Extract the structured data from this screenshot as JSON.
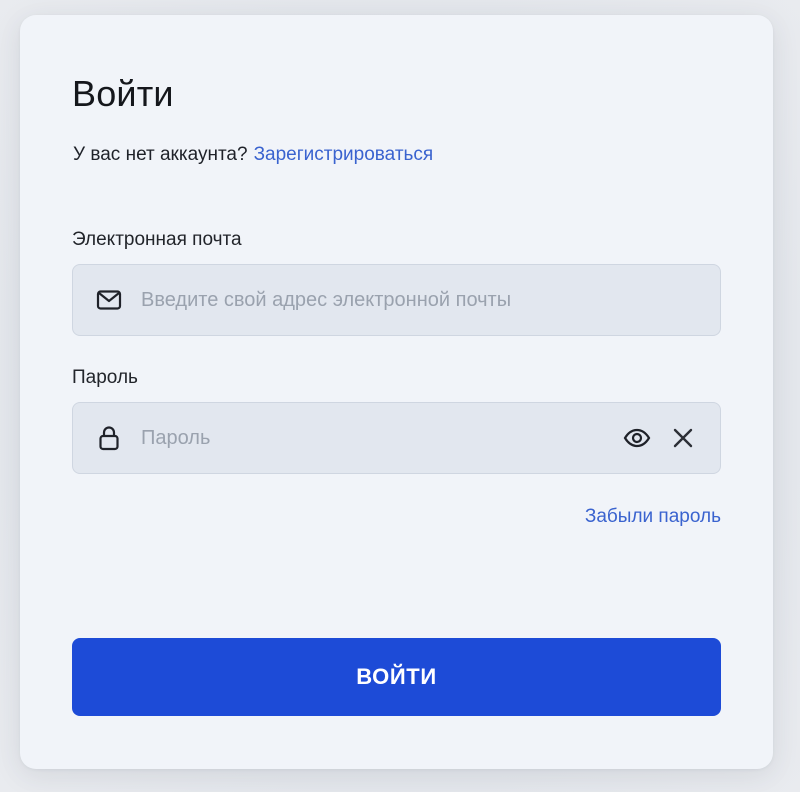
{
  "form": {
    "title": "Войти",
    "signup_prompt": "У вас нет аккаунта?",
    "signup_link": "Зарегистрироваться",
    "email": {
      "label": "Электронная почта",
      "placeholder": "Введите свой адрес электронной почты",
      "value": "",
      "icon": "mail-icon"
    },
    "password": {
      "label": "Пароль",
      "placeholder": "Пароль",
      "value": "",
      "icon": "lock-icon",
      "show_icon": "eye-icon",
      "clear_icon": "close-icon"
    },
    "forgot_link": "Забыли пароль",
    "submit_label": "ВОЙТИ"
  },
  "colors": {
    "accent": "#1d4bd7",
    "link": "#3a63cf",
    "card_background": "#f1f4f9",
    "field_background": "#e2e7ef"
  }
}
